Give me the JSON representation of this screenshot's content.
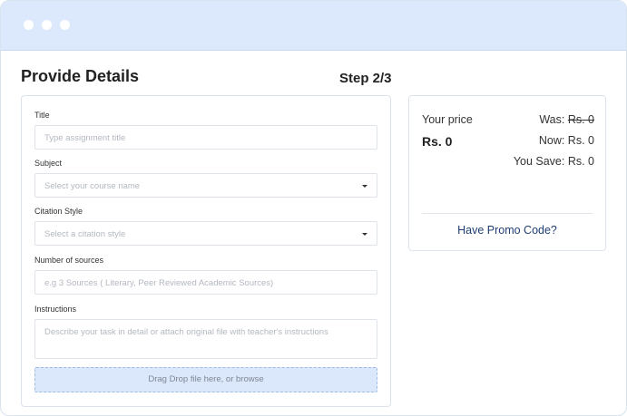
{
  "page": {
    "title": "Provide Details",
    "step": "Step 2/3"
  },
  "form": {
    "title": {
      "label": "Title",
      "placeholder": "Type assignment title"
    },
    "subject": {
      "label": "Subject",
      "placeholder": "Select your course name"
    },
    "citation": {
      "label": "Citation Style",
      "placeholder": "Select a citation style"
    },
    "sources": {
      "label": "Number of sources",
      "placeholder": "e.g 3 Sources ( Literary, Peer Reviewed Academic Sources)"
    },
    "instructions": {
      "label": "Instructions",
      "placeholder": "Describe your task in detail or attach original file with teacher's instructions"
    },
    "dropzone": "Drag Drop file here, or browse"
  },
  "pricing": {
    "your_price_label": "Your price",
    "your_price_value": "Rs. 0",
    "was_label": "Was:",
    "was_value": "Rs. 0",
    "now_label": "Now: Rs. 0",
    "save_label": "You Save: Rs. 0",
    "promo": "Have Promo Code?"
  }
}
